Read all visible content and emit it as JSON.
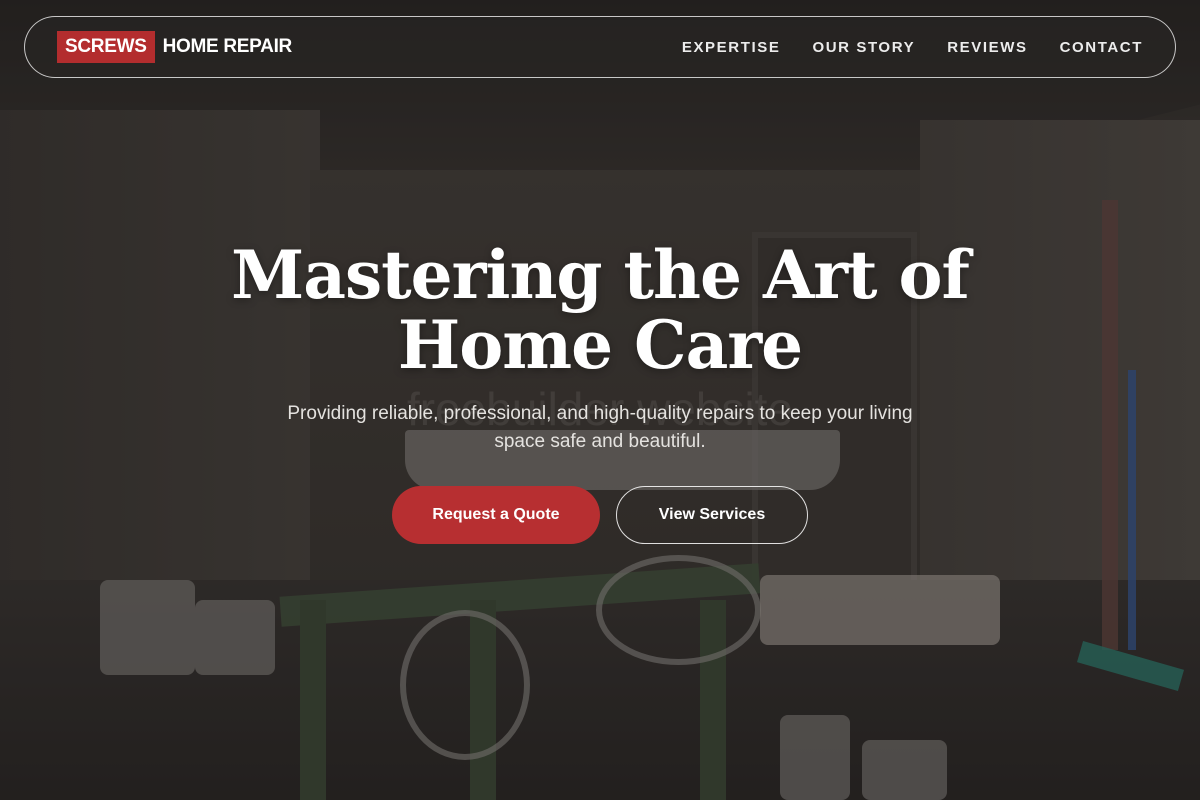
{
  "brand": {
    "badge": "SCREWS",
    "name": "HOME REPAIR"
  },
  "nav": {
    "items": [
      {
        "label": "EXPERTISE"
      },
      {
        "label": "OUR STORY"
      },
      {
        "label": "REVIEWS"
      },
      {
        "label": "CONTACT"
      }
    ]
  },
  "hero": {
    "title_line1": "Mastering the Art of",
    "title_line2": "Home Care",
    "watermark": "freebuilder website",
    "subtitle": "Providing reliable, professional, and high-quality repairs to keep your living space safe and beautiful.",
    "primary_cta": "Request a Quote",
    "secondary_cta": "View Services"
  },
  "colors": {
    "accent": "#b72f31",
    "nav_text": "#ececec",
    "overlay": "#141210"
  }
}
